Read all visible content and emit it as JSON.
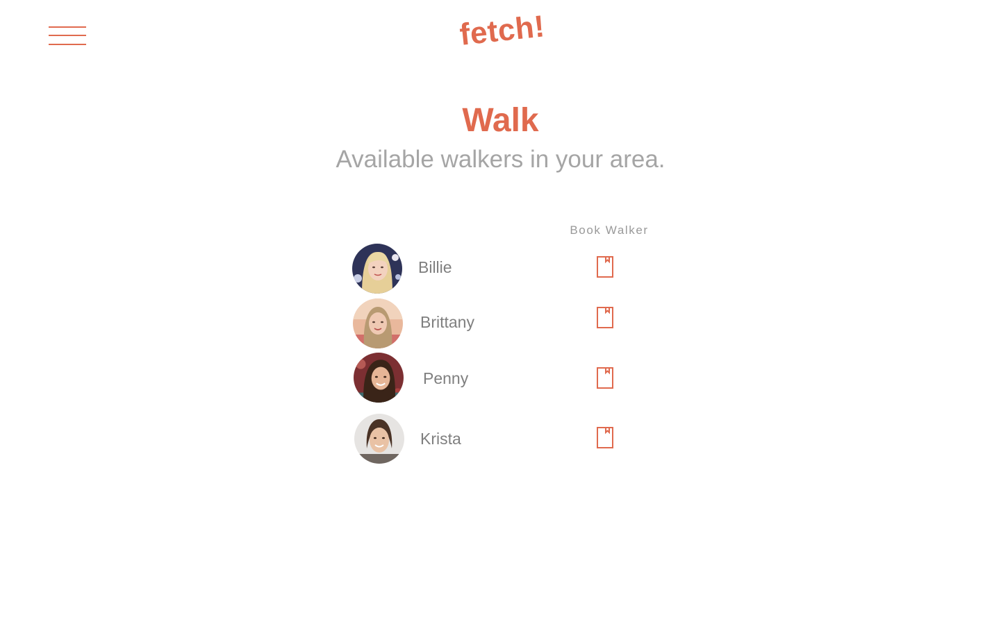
{
  "header": {
    "menu_icon": "hamburger-menu-icon",
    "logo_text": "fetch!"
  },
  "main": {
    "title": "Walk",
    "subtitle": "Available walkers in your area.",
    "column_header": "Book Walker",
    "walkers": [
      {
        "name": "Billie",
        "action_icon": "bookmark-icon"
      },
      {
        "name": "Brittany",
        "action_icon": "bookmark-icon"
      },
      {
        "name": "Penny",
        "action_icon": "bookmark-icon"
      },
      {
        "name": "Krista",
        "action_icon": "bookmark-icon"
      }
    ]
  },
  "colors": {
    "accent": "#e06a4e",
    "subtitle_text": "#a5a5a5",
    "name_text": "#7f7f7f",
    "background": "#ffffff"
  }
}
